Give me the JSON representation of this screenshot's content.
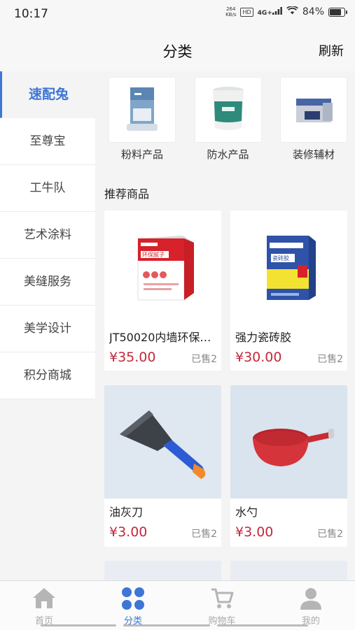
{
  "status_bar": {
    "time": "10:17",
    "net_speed_top": "264",
    "net_speed_bottom": "KB/s",
    "hd": "HD",
    "network": "4G+",
    "battery": "84%",
    "battery_level": 0.84
  },
  "header": {
    "title": "分类",
    "refresh_label": "刷新"
  },
  "sidebar": {
    "items": [
      {
        "label": "速配兔"
      },
      {
        "label": "至尊宝"
      },
      {
        "label": "工牛队"
      },
      {
        "label": "艺术涂料"
      },
      {
        "label": "美缝服务"
      },
      {
        "label": "美学设计"
      },
      {
        "label": "积分商城"
      }
    ]
  },
  "categories": [
    {
      "label": "粉料产品"
    },
    {
      "label": "防水产品"
    },
    {
      "label": "装修辅材"
    }
  ],
  "section_title": "推荐商品",
  "products": [
    {
      "name": "JT50020内墙环保…",
      "price": "¥35.00",
      "sold": "已售2",
      "box_text": "环保腻子"
    },
    {
      "name": "强力瓷砖胶",
      "price": "¥30.00",
      "sold": "已售2",
      "box_text": "瓷砖胶"
    },
    {
      "name": "油灰刀",
      "price": "¥3.00",
      "sold": "已售2"
    },
    {
      "name": "水勺",
      "price": "¥3.00",
      "sold": "已售2"
    }
  ],
  "tabbar": {
    "tabs": [
      {
        "label": "首页"
      },
      {
        "label": "分类"
      },
      {
        "label": "购物车"
      },
      {
        "label": "我的"
      }
    ]
  },
  "colors": {
    "accent": "#3e76d6",
    "price": "#c4283b",
    "background": "#f4f4f4"
  }
}
